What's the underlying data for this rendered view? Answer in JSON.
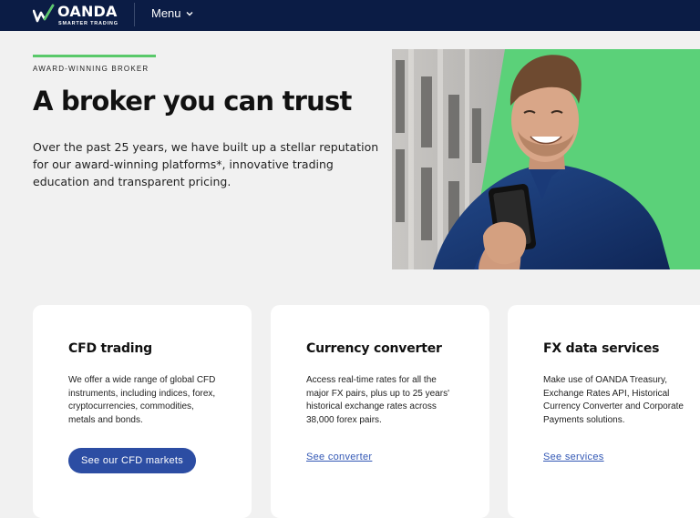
{
  "nav": {
    "brand": "OANDA",
    "tagline": "SMARTER TRADING",
    "menu_label": "Menu",
    "icons": {
      "logo": "oanda-logo-mark",
      "menu": "chevron-down-icon"
    },
    "colors": {
      "background": "#0b1c45",
      "text": "#ffffff"
    }
  },
  "hero": {
    "eyebrow": "AWARD-WINNING BROKER",
    "title": "A broker you can trust",
    "intro": "Over the past 25 years, we have built up a stellar reputation for our award-winning platforms*, innovative trading education and transparent pricing.",
    "accent_color": "#59c96a"
  },
  "cards": [
    {
      "title": "CFD trading",
      "description": "We offer a wide range of global CFD instruments, including indices, forex, cryptocurrencies, commodities, metals and bonds.",
      "cta": "See our CFD markets",
      "cta_style": "button"
    },
    {
      "title": "Currency converter",
      "description": "Access real-time rates for all the major FX pairs, plus up to 25 years' historical exchange rates across 38,000 forex pairs.",
      "cta": "See converter",
      "cta_style": "link"
    },
    {
      "title": "FX data services",
      "description": "Make use of OANDA Treasury, Exchange Rates API, Historical Currency Converter and Corporate Payments solutions.",
      "cta": "See services",
      "cta_style": "link"
    }
  ]
}
